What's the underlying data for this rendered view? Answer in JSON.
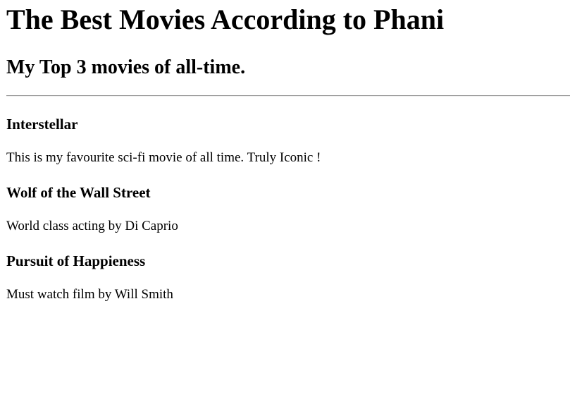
{
  "header": {
    "title": "The Best Movies According to Phani",
    "subtitle": "My Top 3 movies of all-time."
  },
  "movies": [
    {
      "title": "Interstellar",
      "description": "This is my favourite sci-fi movie of all time. Truly Iconic !"
    },
    {
      "title": "Wolf of the Wall Street",
      "description": "World class acting by Di Caprio"
    },
    {
      "title": "Pursuit of Happieness",
      "description": "Must watch film by Will Smith"
    }
  ],
  "colors": {
    "background": "#ffffff",
    "text": "#000000",
    "divider": "#9a9a9a"
  }
}
